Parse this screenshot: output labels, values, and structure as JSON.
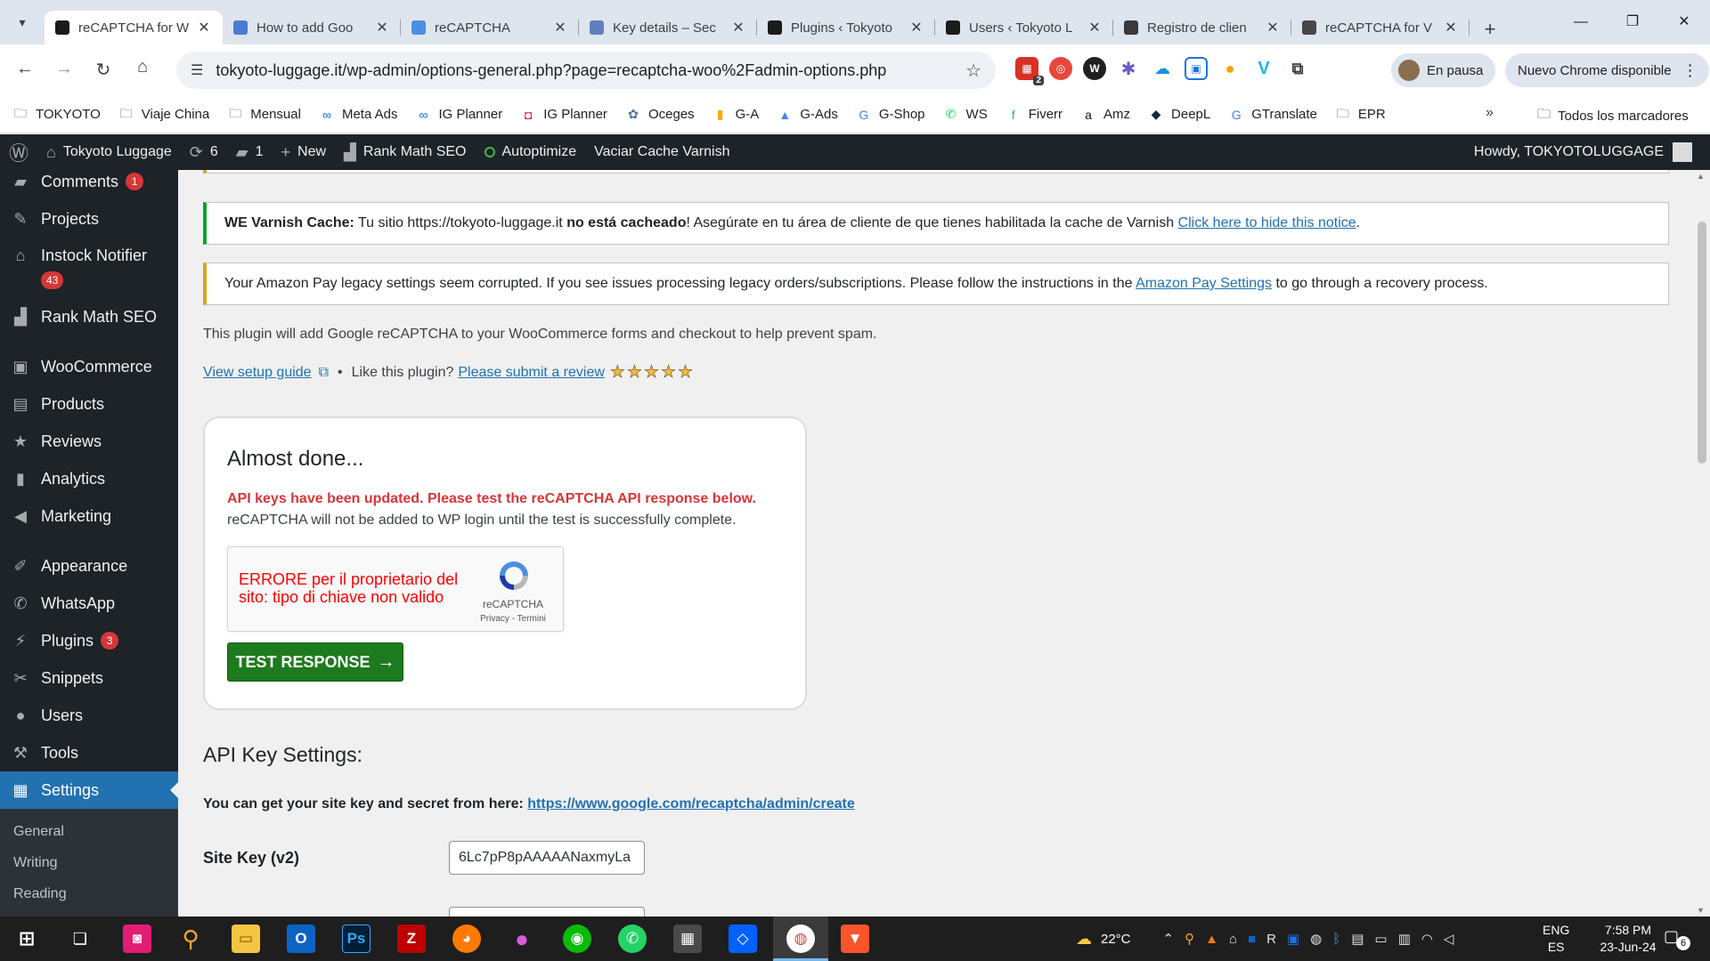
{
  "browser": {
    "tabs": [
      {
        "title": "reCAPTCHA for W",
        "active": true,
        "fav_color": "#1b1b1b",
        "icon": "tokyoto-favicon"
      },
      {
        "title": "How to add Goo",
        "fav_color": "#4a7bd3",
        "icon": "recaptcha-docs-favicon"
      },
      {
        "title": "reCAPTCHA",
        "fav_color": "#4a90e2",
        "icon": "recaptcha-favicon"
      },
      {
        "title": "Key details – Sec",
        "fav_color": "#5f7fbf",
        "icon": "shield-favicon"
      },
      {
        "title": "Plugins ‹ Tokyoto",
        "fav_color": "#1b1b1b",
        "icon": "tokyoto-favicon"
      },
      {
        "title": "Users ‹ Tokyoto L",
        "fav_color": "#1b1b1b",
        "icon": "tokyoto-favicon"
      },
      {
        "title": "Registro de clien",
        "fav_color": "#3a3a3a",
        "icon": "w-favicon"
      },
      {
        "title": "reCAPTCHA for V",
        "fav_color": "#464646",
        "icon": "wordpress-favicon"
      }
    ],
    "url": "tokyoto-luggage.it/wp-admin/options-general.php?page=recaptcha-woo%2Fadmin-options.php",
    "profile_label": "En pausa",
    "update_label": "Nuevo Chrome disponible",
    "extension_badge": "2",
    "bookmarks": [
      {
        "label": "TOKYOTO",
        "icon": "folder-icon"
      },
      {
        "label": "Viaje China",
        "icon": "folder-icon"
      },
      {
        "label": "Mensual",
        "icon": "folder-icon"
      },
      {
        "label": "Meta Ads",
        "icon": "meta-icon"
      },
      {
        "label": "IG Planner",
        "icon": "meta-icon"
      },
      {
        "label": "IG Planner",
        "icon": "instagram-icon"
      },
      {
        "label": "Oceges",
        "icon": "oceges-icon"
      },
      {
        "label": "G-A",
        "icon": "analytics-icon"
      },
      {
        "label": "G-Ads",
        "icon": "google-ads-icon"
      },
      {
        "label": "G-Shop",
        "icon": "google-icon"
      },
      {
        "label": "WS",
        "icon": "whatsapp-icon"
      },
      {
        "label": "Fiverr",
        "icon": "fiverr-icon"
      },
      {
        "label": "Amz",
        "icon": "amazon-icon"
      },
      {
        "label": "DeepL",
        "icon": "deepl-icon"
      },
      {
        "label": "GTranslate",
        "icon": "gtranslate-icon"
      },
      {
        "label": "EPR",
        "icon": "folder-icon"
      }
    ],
    "bookmarks_more": "»",
    "all_bookmarks": "Todos los marcadores"
  },
  "adminbar": {
    "site_name": "Tokyoto Luggage",
    "updates_count": "6",
    "comments_count": "1",
    "new_label": "New",
    "rankmath_label": "Rank Math SEO",
    "autoptimize_label": "Autoptimize",
    "varnish_label": "Vaciar Cache Varnish",
    "howdy": "Howdy, TOKYOTOLUGGAGE"
  },
  "sidebar": {
    "items": [
      {
        "label": "Comments",
        "icon": "comments-icon",
        "badge": "1"
      },
      {
        "label": "Projects",
        "icon": "pin-icon"
      },
      {
        "label": "Instock Notifier",
        "icon": "bank-icon",
        "badge": "43"
      },
      {
        "label": "Rank Math SEO",
        "icon": "rankmath-icon"
      },
      {
        "label": "WooCommerce",
        "icon": "woo-icon"
      },
      {
        "label": "Products",
        "icon": "archive-icon"
      },
      {
        "label": "Reviews",
        "icon": "star-icon"
      },
      {
        "label": "Analytics",
        "icon": "bar-chart-icon"
      },
      {
        "label": "Marketing",
        "icon": "megaphone-icon"
      },
      {
        "label": "Appearance",
        "icon": "brush-icon"
      },
      {
        "label": "WhatsApp",
        "icon": "whatsapp-icon"
      },
      {
        "label": "Plugins",
        "icon": "plug-icon",
        "badge": "3"
      },
      {
        "label": "Snippets",
        "icon": "scissors-icon"
      },
      {
        "label": "Users",
        "icon": "user-icon"
      },
      {
        "label": "Tools",
        "icon": "wrench-icon"
      },
      {
        "label": "Settings",
        "icon": "settings-icon",
        "current": true
      }
    ],
    "submenu": [
      "General",
      "Writing",
      "Reading"
    ]
  },
  "notices": {
    "varnish": {
      "prefix": "WE Varnish Cache:",
      "text1": " Tu sitio https://tokyoto-luggage.it ",
      "bold": "no está cacheado",
      "text2": "! Asegúrate en tu área de cliente de que tienes habilitada la cache de Varnish ",
      "link": "Click here to hide this notice",
      "end": "."
    },
    "amazon": {
      "text1": "Your Amazon Pay legacy settings seem corrupted. If you see issues processing legacy orders/subscriptions. Please follow the instructions in the ",
      "link": "Amazon Pay Settings",
      "text2": " to go through a recovery process."
    }
  },
  "main": {
    "description": "This plugin will add Google reCAPTCHA to your WooCommerce forms and checkout to help prevent spam.",
    "setup_guide": "View setup guide",
    "bullet": "•",
    "like_text": "Like this plugin?",
    "review_link": "Please submit a review",
    "stars": "★★★★★",
    "rating_stars": 5,
    "card": {
      "title": "Almost done...",
      "error": "API keys have been updated. Please test the reCAPTCHA API response below.",
      "note": "reCAPTCHA will not be added to WP login until the test is successfully complete.",
      "recaptcha_error": "ERRORE per il proprietario del sito: tipo di chiave non valido",
      "recaptcha_brand": "reCAPTCHA",
      "recaptcha_links": "Privacy - Termini",
      "button": "TEST RESPONSE",
      "button_arrow": "→"
    },
    "api_heading": "API Key Settings:",
    "api_intro": "You can get your site key and secret from here: ",
    "api_link": "https://www.google.com/recaptcha/admin/create",
    "site_key_label": "Site Key (v2)",
    "site_key_value": "6Lc7pP8pAAAAANaxmyLa"
  },
  "taskbar": {
    "temperature": "22°C",
    "lang_top": "ENG",
    "lang_bottom": "ES",
    "time": "7:58 PM",
    "date": "23-Jun-24",
    "notifications": "6"
  },
  "colors": {
    "wp_admin_dark": "#1d2327",
    "wp_blue": "#2271b1",
    "error_red": "#d63638",
    "test_green": "#1e7a1e"
  }
}
